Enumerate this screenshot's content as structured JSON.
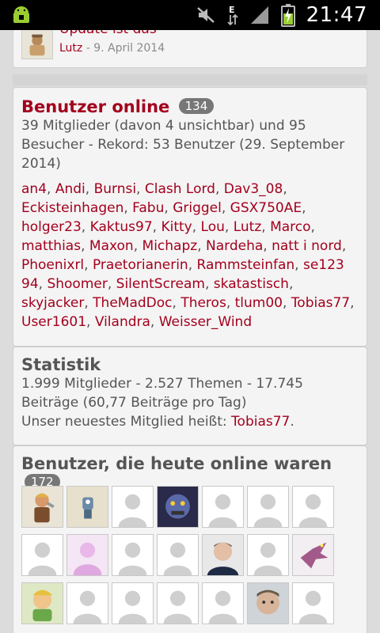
{
  "statusbar": {
    "time": "21:47",
    "icons": [
      "android-debug-icon",
      "mute-icon",
      "data-arrows-icon",
      "signal-icon",
      "battery-charging-icon"
    ]
  },
  "last_post": {
    "title": "Update ist das",
    "author": "Lutz",
    "separator": " - ",
    "date": "9. April 2014"
  },
  "online": {
    "title": "Benutzer online",
    "count": "134",
    "summary": "39 Mitglieder (davon 4 unsichtbar) und 95 Besucher - Rekord: 53 Benutzer (29. September 2014)",
    "members": [
      "an4",
      "Andi",
      "Burnsi",
      "Clash Lord",
      "Dav3_08",
      "Eckisteinhagen",
      "Fabu",
      "Griggel",
      "GSX750AE",
      "holger23",
      "Kaktus97",
      "Kitty",
      "Lou",
      "Lutz",
      "Marco",
      "matthias",
      "Maxon",
      "Michapz",
      "Nardeha",
      "natt i nord",
      "Phoenixrl",
      "Praetorianerin",
      "Rammsteinfan",
      "se123 94",
      "Shoomer",
      "SilentScream",
      "skatastisch",
      "skyjacker",
      "TheMadDoc",
      "Theros",
      "tlum00",
      "Tobias77",
      "User1601",
      "Vilandra",
      "Weisser_Wind"
    ]
  },
  "stats": {
    "title": "Statistik",
    "line1": "1.999 Mitglieder - 2.527 Themen - 17.745 Beiträge (60,77 Beiträge pro Tag)",
    "newest_prefix": "Unser neuestes Mitglied heißt: ",
    "newest_member": "Tobias77",
    "newest_suffix": "."
  },
  "today": {
    "title": "Benutzer, die heute online waren",
    "count": "172",
    "avatars": [
      "barbarian",
      "robot",
      "default",
      "golem",
      "default",
      "default",
      "default",
      "default",
      "pink-figure",
      "default",
      "default",
      "man-photo",
      "default",
      "dragon",
      "cartoon",
      "default",
      "default",
      "default",
      "default",
      "face-photo",
      "default"
    ]
  },
  "colors": {
    "link": "#a3001d",
    "text": "#555555",
    "badge": "#777777",
    "card": "#f4f4f4",
    "background": "#dcdcdc"
  }
}
